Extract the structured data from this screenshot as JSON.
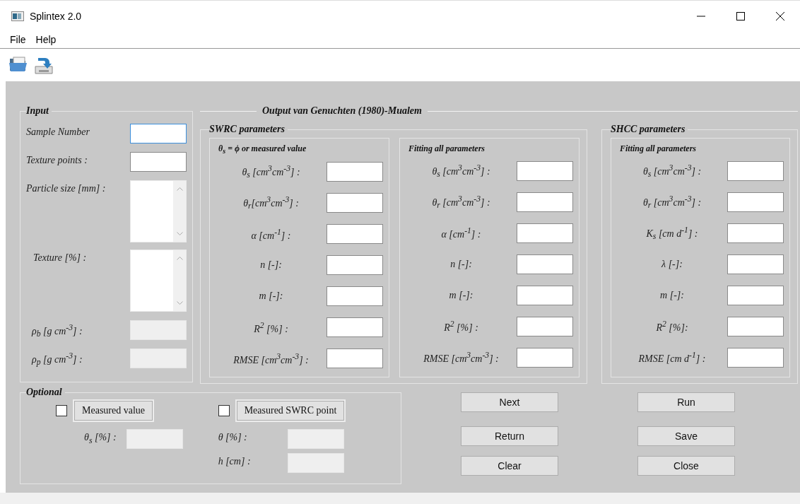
{
  "window": {
    "title": "Splintex 2.0"
  },
  "menu": [
    "File",
    "Help"
  ],
  "input": {
    "title": "Input",
    "fields": [
      {
        "label": "Sample Number",
        "kind": "text",
        "focused": true,
        "disabled": false
      },
      {
        "label": "Texture points :",
        "kind": "text",
        "focused": false,
        "disabled": false
      },
      {
        "label": "Particle size [mm] :",
        "kind": "list",
        "focused": false,
        "disabled": false
      },
      {
        "label": "Texture [%] :",
        "kind": "list",
        "focused": false,
        "disabled": false
      },
      {
        "label": "ρ$_{b}$  [g cm$^{-3}$] :",
        "kind": "text",
        "focused": false,
        "disabled": true
      },
      {
        "label": "ρ$_{p}$  [g cm$^{-3}$] :",
        "kind": "text",
        "focused": false,
        "disabled": true
      }
    ]
  },
  "output": {
    "title": "Output van Genuchten (1980)-Mualem",
    "sections": [
      {
        "title": "SWRC parameters",
        "groups": [
          {
            "title": "θ$_{s}$ = ϕ or measured value",
            "rows": [
              "θ$_{s}$ [cm$^{3}$cm$^{-3}$] :",
              "θ$_{r}$[cm$^{3}$cm$^{-3}$] :",
              "α [cm$^{-1}$] :",
              "n  [-]:",
              "m [-]:",
              "R$^{2}$  [%] :",
              "RMSE  [cm$^{3}$cm$^{-3}$] :"
            ]
          },
          {
            "title": "Fitting all parameters",
            "rows": [
              "θ$_{s}$ [cm$^{3}$cm$^{-3}$] :",
              "θ$_{r}$ [cm$^{3}$cm$^{-3}$] :",
              "α [cm$^{-1}$] :",
              "n  [-]:",
              "m [-]:",
              "R$^{2}$  [%] :",
              "RMSE [cm$^{3}$cm$^{-3}$] :"
            ]
          }
        ]
      },
      {
        "title": "SHCC parameters",
        "groups": [
          {
            "title": "Fitting all parameters",
            "rows": [
              "θ$_{s}$  [cm$^{3}$cm$^{-3}$] :",
              "θ$_{r}$  [cm$^{3}$cm$^{-3}$] :",
              "K$_{s}$  [cm d$^{-1}$] :",
              "λ   [-]:",
              "m   [-]:",
              "R$^{2}$  [%]:",
              "RMSE   [cm d$^{-1}$] :"
            ]
          }
        ]
      }
    ]
  },
  "optional": {
    "title": "Optional",
    "columns": [
      {
        "checked": false,
        "button": "Measured value",
        "fields": [
          "θ$_{s}$  [%] :"
        ]
      },
      {
        "checked": false,
        "button": "Measured SWRC point",
        "fields": [
          "θ  [%] :",
          "h [cm] :"
        ]
      }
    ]
  },
  "buttons": [
    [
      "Next",
      "Return",
      "Clear"
    ],
    [
      "Run",
      "Save",
      "Close"
    ]
  ]
}
